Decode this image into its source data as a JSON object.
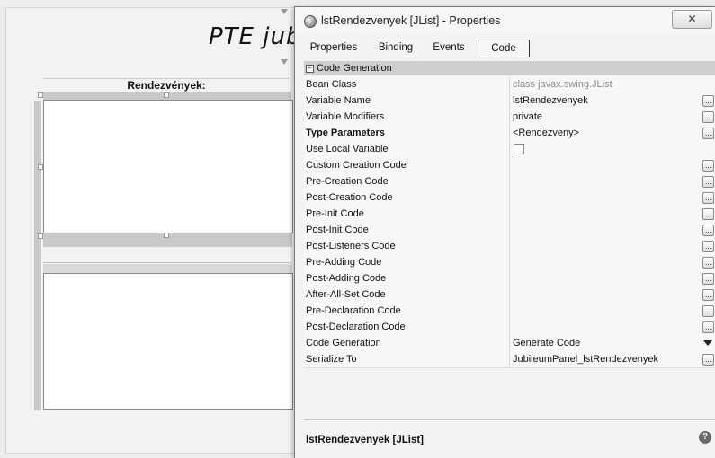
{
  "designer": {
    "title": "PTE jub",
    "heading": "Rendezvények:"
  },
  "dialog": {
    "title": "lstRendezvenyek [JList] - Properties",
    "close_glyph": "✕",
    "tabs": [
      "Properties",
      "Binding",
      "Events",
      "Code"
    ],
    "active_tab": "Code",
    "category": {
      "toggle": "−",
      "label": "Code Generation"
    },
    "properties": [
      {
        "name": "Bean Class",
        "value": "class javax.swing.JList",
        "style": "gray"
      },
      {
        "name": "Variable Name",
        "value": "lstRendezvenyek",
        "editor": "ellipsis"
      },
      {
        "name": "Variable Modifiers",
        "value": "private",
        "editor": "ellipsis"
      },
      {
        "name": "Type Parameters",
        "value": "<Rendezveny>",
        "editor": "ellipsis",
        "bold": true
      },
      {
        "name": "Use Local Variable",
        "value": "",
        "editor": "checkbox"
      },
      {
        "name": "Custom Creation Code",
        "value": "",
        "editor": "ellipsis"
      },
      {
        "name": "Pre-Creation Code",
        "value": "",
        "editor": "ellipsis"
      },
      {
        "name": "Post-Creation Code",
        "value": "",
        "editor": "ellipsis"
      },
      {
        "name": "Pre-Init Code",
        "value": "",
        "editor": "ellipsis"
      },
      {
        "name": "Post-Init Code",
        "value": "",
        "editor": "ellipsis"
      },
      {
        "name": "Post-Listeners Code",
        "value": "",
        "editor": "ellipsis"
      },
      {
        "name": "Pre-Adding Code",
        "value": "",
        "editor": "ellipsis"
      },
      {
        "name": "Post-Adding Code",
        "value": "",
        "editor": "ellipsis"
      },
      {
        "name": "After-All-Set Code",
        "value": "",
        "editor": "ellipsis"
      },
      {
        "name": "Pre-Declaration Code",
        "value": "",
        "editor": "ellipsis"
      },
      {
        "name": "Post-Declaration Code",
        "value": "",
        "editor": "ellipsis"
      },
      {
        "name": "Code Generation",
        "value": "Generate Code",
        "editor": "dropdown"
      },
      {
        "name": "Serialize To",
        "value": "JubileumPanel_lstRendezvenyek",
        "editor": "ellipsis"
      }
    ],
    "ellipsis_glyph": "...",
    "description_title": "lstRendezvenyek [JList]",
    "help_glyph": "?"
  }
}
